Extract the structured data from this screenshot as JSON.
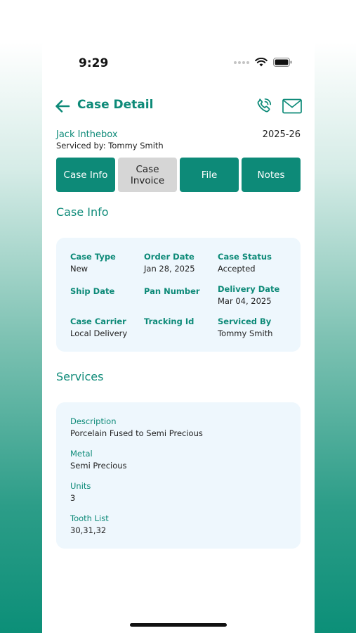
{
  "status_bar": {
    "time": "9:29"
  },
  "header": {
    "title": "Case Detail"
  },
  "patient": {
    "name": "Jack Inthebox",
    "serviced_by": "Serviced by: Tommy Smith",
    "year": "2025-26"
  },
  "tabs": [
    {
      "label": "Case Info",
      "active": true
    },
    {
      "label": "Case\nInvoice",
      "active": false
    },
    {
      "label": "File",
      "active": true
    },
    {
      "label": "Notes",
      "active": true
    }
  ],
  "case_info": {
    "title": "Case Info",
    "fields": [
      {
        "label": "Case Type",
        "value": "New"
      },
      {
        "label": "Order Date",
        "value": "Jan 28, 2025"
      },
      {
        "label": "Case Status",
        "value": "Accepted"
      },
      {
        "label": "Ship Date",
        "value": ""
      },
      {
        "label": "Pan Number",
        "value": ""
      },
      {
        "label": "Delivery Date",
        "value": "Mar 04, 2025"
      },
      {
        "label": "Case Carrier",
        "value": "Local Delivery"
      },
      {
        "label": "Tracking Id",
        "value": ""
      },
      {
        "label": "Serviced By",
        "value": "Tommy Smith"
      }
    ]
  },
  "services": {
    "title": "Services",
    "items": [
      {
        "label": "Description",
        "value": "Porcelain Fused to Semi Precious"
      },
      {
        "label": "Metal",
        "value": "Semi Precious"
      },
      {
        "label": "Units",
        "value": "3"
      },
      {
        "label": "Tooth List",
        "value": "30,31,32"
      }
    ]
  },
  "colors": {
    "accent": "#0d8a78",
    "card_bg": "#eef7fd",
    "inactive_tab": "#d6d6d6"
  }
}
